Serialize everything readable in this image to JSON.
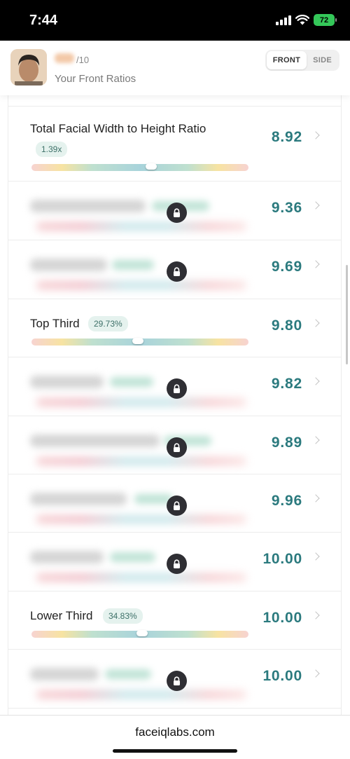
{
  "status_bar": {
    "time": "7:44",
    "battery": "72"
  },
  "header": {
    "score_suffix": "/10",
    "subtitle": "Your Front Ratios",
    "tabs": [
      {
        "label": "FRONT",
        "active": true
      },
      {
        "label": "SIDE",
        "active": false
      }
    ]
  },
  "ratios": [
    {
      "label": "Total Facial Width to Height Ratio",
      "badge": "1.39x",
      "value": "8.92",
      "locked": false,
      "marker_fraction": 0.55
    },
    {
      "label": "",
      "badge": "",
      "value": "9.36",
      "locked": true
    },
    {
      "label": "",
      "badge": "",
      "value": "9.69",
      "locked": true
    },
    {
      "label": "Top Third",
      "badge": "29.73%",
      "value": "9.80",
      "locked": false,
      "marker_fraction": 0.49
    },
    {
      "label": "",
      "badge": "",
      "value": "9.82",
      "locked": true
    },
    {
      "label": "",
      "badge": "",
      "value": "9.89",
      "locked": true
    },
    {
      "label": "",
      "badge": "",
      "value": "9.96",
      "locked": true
    },
    {
      "label": "",
      "badge": "",
      "value": "10.00",
      "locked": true
    },
    {
      "label": "Lower Third",
      "badge": "34.83%",
      "value": "10.00",
      "locked": false,
      "marker_fraction": 0.51
    },
    {
      "label": "",
      "badge": "",
      "value": "10.00",
      "locked": true
    }
  ],
  "url_bar": {
    "url": "faceiqlabs.com"
  }
}
